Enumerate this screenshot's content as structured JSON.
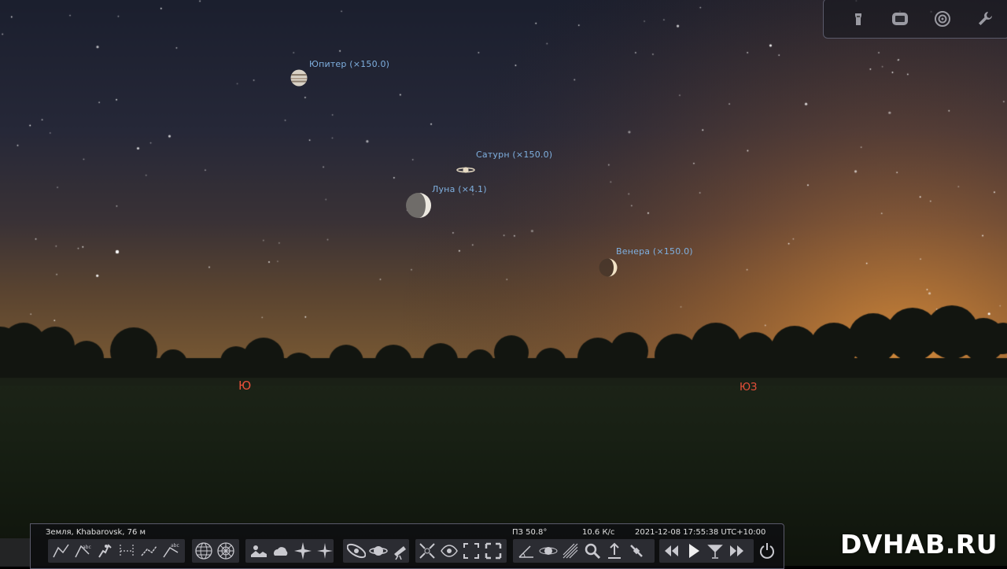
{
  "sky_labels": {
    "jupiter": "Юпитер (×150.0)",
    "saturn": "Сатурн (×150.0)",
    "moon": "Луна (×4.1)",
    "venus": "Венера (×150.0)"
  },
  "cardinals": {
    "south": "Ю",
    "southwest": "ЮЗ"
  },
  "status_bar": {
    "location": "Земля, Khabarovsk, 76 м",
    "fov": "ПЗ 50.8°",
    "fps": "10.6 К/с",
    "datetime": "2021-12-08 17:55:38 UTC+10:00"
  },
  "top_toolbar": {
    "buttons": [
      "ocular-icon",
      "screen-frame-icon",
      "target-icon",
      "wrench-icon"
    ]
  },
  "bottom_toolbar": {
    "buttons": [
      "constellation-lines-icon",
      "constellation-labels-icon",
      "constellation-art-icon",
      "constellation-boundaries-icon",
      "asterism-lines-icon",
      "asterism-labels-icon",
      "equatorial-grid-icon",
      "azimuthal-grid-icon",
      "ground-icon",
      "atmosphere-icon",
      "cardinal-points-icon",
      "nebulae-icon",
      "dso-icon",
      "planet-labels-icon",
      "telescope-icon",
      "ocular-mode-icon",
      "satellites-icon",
      "observing-list-icon",
      "fullscreen-icon",
      "angle-measure-icon",
      "solar-system-icon",
      "meteor-showers-icon",
      "search-icon",
      "night-mode-icon",
      "satellite-icon",
      "rewind-icon",
      "play-icon",
      "realtime-icon",
      "fast-forward-icon",
      "quit-icon"
    ]
  },
  "watermark": "DVHAB.RU",
  "colors": {
    "label": "#7fb0e0",
    "cardinal": "#e8503a"
  }
}
